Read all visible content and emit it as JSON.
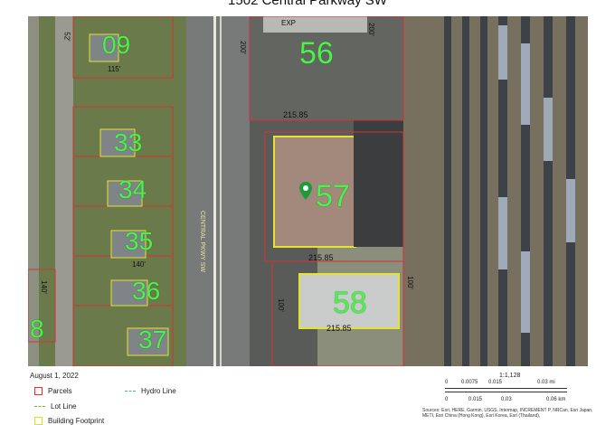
{
  "title": "1502 Central Parkway SW",
  "parcels": [
    {
      "number": "09"
    },
    {
      "number": "56"
    },
    {
      "number": "33"
    },
    {
      "number": "34"
    },
    {
      "number": "57"
    },
    {
      "number": "35"
    },
    {
      "number": "36"
    },
    {
      "number": "58"
    },
    {
      "number": "37"
    },
    {
      "number": "8"
    }
  ],
  "dimensions": [
    "52'",
    "115'",
    "200'",
    "200'",
    "215.85",
    "140'",
    "215.85",
    "215.85",
    "100'",
    "100'",
    "140'"
  ],
  "road_labels": [
    "CENTRAL PKWY SW",
    "EXP"
  ],
  "date": "August 1, 2022",
  "legend": {
    "parcels": "Parcels",
    "lot_line": "Lot Line",
    "building_footprint": "Building Footprint",
    "hydro_line": "Hydro Line"
  },
  "scale": {
    "ratio": "1:1,128",
    "mi_ticks": [
      "0",
      "0.0075",
      "0.015",
      "0.03 mi"
    ],
    "km_ticks": [
      "0",
      "0.015",
      "0.03",
      "0.06 km"
    ]
  },
  "sources": "Sources: Esri, HERE, Garmin, USGS, Intermap, INCREMENT P, NRCan, Esri Japan, METI, Esri China (Hong Kong), Esri Korea, Esri (Thailand),",
  "colors": {
    "parcel": "#d33333",
    "label": "#4df04d",
    "footprint": "#e3e330",
    "pin": "#1e9a3c"
  }
}
